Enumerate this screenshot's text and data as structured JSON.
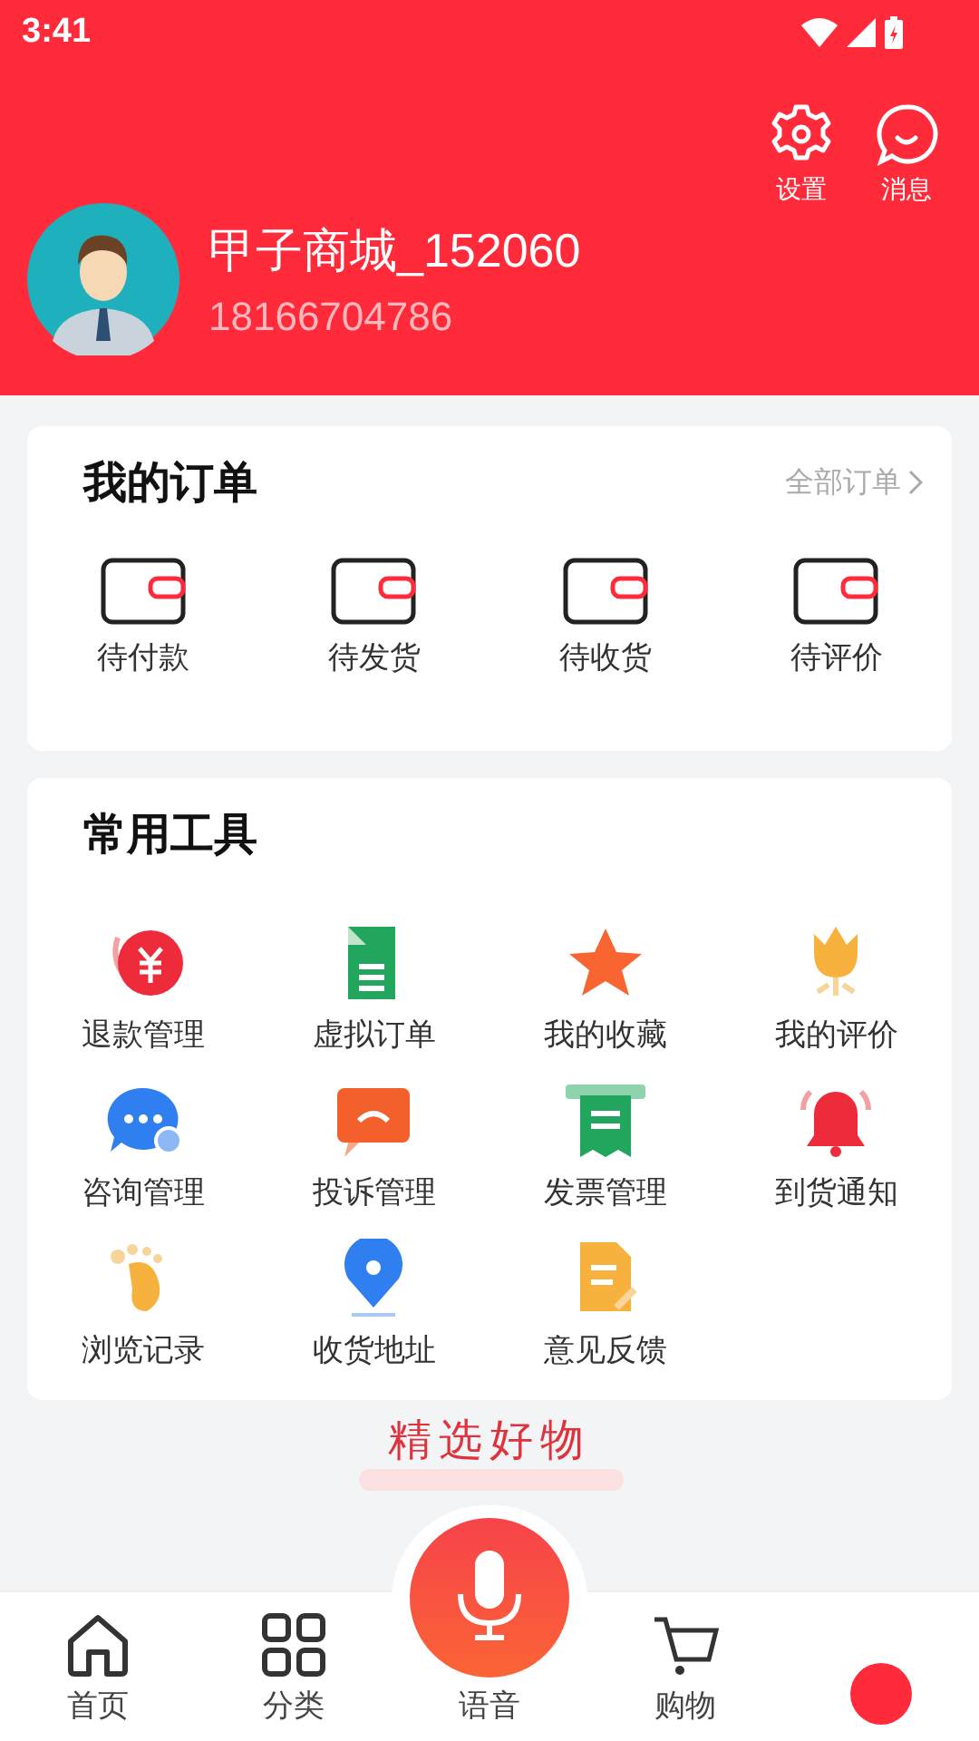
{
  "status_bar": {
    "time": "3:41"
  },
  "header": {
    "actions": [
      {
        "label": "设置"
      },
      {
        "label": "消息"
      }
    ],
    "username": "甲子商城_152060",
    "phone": "18166704786"
  },
  "orders": {
    "title": "我的订单",
    "more": "全部订单",
    "items": [
      {
        "label": "待付款"
      },
      {
        "label": "待发货"
      },
      {
        "label": "待收货"
      },
      {
        "label": "待评价"
      }
    ]
  },
  "tools": {
    "title": "常用工具",
    "items": [
      {
        "label": "退款管理"
      },
      {
        "label": "虚拟订单"
      },
      {
        "label": "我的收藏"
      },
      {
        "label": "我的评价"
      },
      {
        "label": "咨询管理"
      },
      {
        "label": "投诉管理"
      },
      {
        "label": "发票管理"
      },
      {
        "label": "到货通知"
      },
      {
        "label": "浏览记录"
      },
      {
        "label": "收货地址"
      },
      {
        "label": "意见反馈"
      }
    ]
  },
  "featured": {
    "title": "精选好物"
  },
  "tab_bar": {
    "tabs": [
      {
        "label": "首页",
        "selected": false
      },
      {
        "label": "分类",
        "selected": false
      },
      {
        "label": "语音",
        "selected": false
      },
      {
        "label": "购物",
        "selected": false
      },
      {
        "selected": true
      }
    ]
  }
}
